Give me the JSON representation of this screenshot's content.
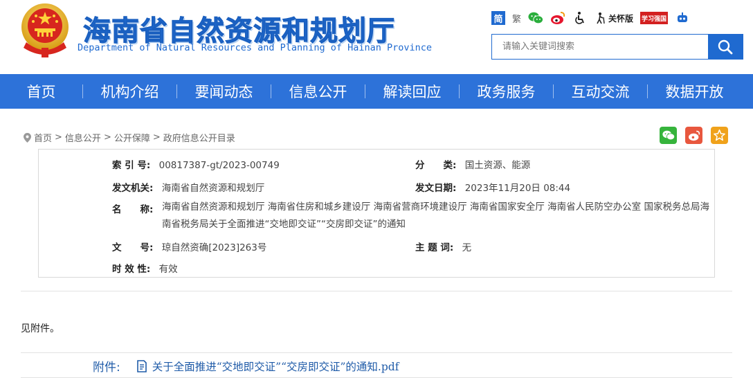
{
  "header": {
    "site_title": "海南省自然资源和规划厅",
    "site_subtitle": "Department of Natural Resources and Planning of Hainan Province",
    "tools": {
      "simplified": "简",
      "traditional": "繁",
      "care_mode": "关怀版",
      "badge": "学习强国"
    },
    "search": {
      "placeholder": "请输入关键词搜索"
    }
  },
  "nav": {
    "items": [
      {
        "label": "首页"
      },
      {
        "label": "机构介绍"
      },
      {
        "label": "要闻动态"
      },
      {
        "label": "信息公开"
      },
      {
        "label": "解读回应"
      },
      {
        "label": "政务服务"
      },
      {
        "label": "互动交流"
      },
      {
        "label": "数据开放"
      }
    ]
  },
  "breadcrumb": {
    "items": [
      "首页",
      "信息公开",
      "公开保障",
      "政府信息公开目录"
    ],
    "separator": ">"
  },
  "meta": {
    "index_label": "索 引 号:",
    "index_value": "00817387-gt/2023-00749",
    "category_label": "分　　类:",
    "category_value": "国土资源、能源",
    "issuer_label": "发文机关:",
    "issuer_value": "海南省自然资源和规划厅",
    "date_label": "发文日期:",
    "date_value": "2023年11月20日 08:44",
    "name_label": "名　　称:",
    "name_value": "海南省自然资源和规划厅 海南省住房和城乡建设厅 海南省营商环境建设厅 海南省国家安全厅 海南省人民防空办公室 国家税务总局海南省税务局关于全面推进“交地即交证”“交房即交证”的通知",
    "docno_label": "文　　号:",
    "docno_value": "琼自然资确[2023]263号",
    "subject_label": "主 题 词:",
    "subject_value": "无",
    "validity_label": "时 效 性:",
    "validity_value": "有效"
  },
  "content": {
    "body": "见附件。",
    "attachment_label": "附件:",
    "attachment_file": "关于全面推进“交地即交证”“交房即交证”的通知.pdf"
  },
  "colors": {
    "brand": "#2d72d9",
    "title": "#1f6ad0",
    "link": "#1f5ba8"
  }
}
